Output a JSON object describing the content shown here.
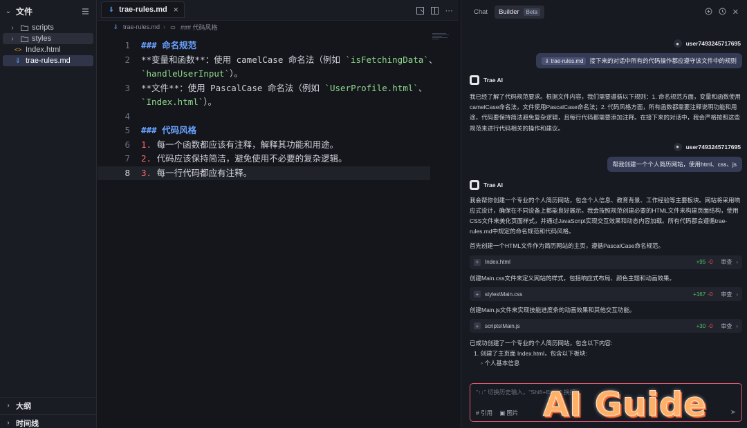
{
  "explorer": {
    "title": "文件",
    "items": [
      {
        "label": "scripts",
        "type": "folder"
      },
      {
        "label": "styles",
        "type": "folder"
      },
      {
        "label": "Index.html",
        "type": "html"
      },
      {
        "label": "trae-rules.md",
        "type": "md"
      }
    ],
    "outline_label": "大纲",
    "timeline_label": "时间线"
  },
  "editor": {
    "tab_label": "trae-rules.md",
    "tab_close": "×",
    "breadcrumb": [
      "trae-rules.md",
      "### 代码风格"
    ],
    "lines": [
      {
        "n": "1",
        "heading": "### 命名规范"
      },
      {
        "n": "2",
        "pre": "**变量和函数**：使用 camelCase 命名法（例如 ",
        "code": "`isFetchingData`",
        "post": "、"
      },
      {
        "n": "",
        "code": "`handleUserInput`",
        "post": "）。"
      },
      {
        "n": "3",
        "pre": "**文件**：使用 PascalCase 命名法（例如 ",
        "code": "`UserProfile.html`",
        "post": "、"
      },
      {
        "n": "",
        "code": "`Index.html`",
        "post": "）。"
      },
      {
        "n": "4",
        "pre": ""
      },
      {
        "n": "5",
        "heading": "### 代码风格"
      },
      {
        "n": "6",
        "num": "1.",
        "post": " 每一个函数都应该有注释，解释其功能和用途。"
      },
      {
        "n": "7",
        "num": "2.",
        "post": " 代码应该保持简洁，避免使用不必要的复杂逻辑。"
      },
      {
        "n": "8",
        "num": "3.",
        "post": " 每一行代码都应有注释。"
      }
    ]
  },
  "chat": {
    "tab_chat": "Chat",
    "tab_builder": "Builder",
    "beta": "Beta",
    "user_name": "user7493245717695",
    "ai_name": "Trae AI",
    "msg1_chip": "trae-rules.md",
    "msg1_text": "接下来的对话中所有的代码操作都应遵守该文件中的规则",
    "reply1": "我已经了解了代码规范要求。根据文件内容，我们需要遵循以下规则：1. 命名规范方面，变量和函数使用camelCase命名法，文件使用PascalCase命名法；2. 代码风格方面，所有函数都需要注释说明功能和用途，代码要保持简洁避免复杂逻辑，且每行代码都需要添加注释。在接下来的对话中，我会严格按照这些规范来进行代码相关的操作和建议。",
    "msg2_text": "帮我创建一个个人简历网站，使用html、css、js",
    "reply2": "我会帮你创建一个专业的个人简历网站，包含个人信息、教育背景、工作经验等主要板块。网站将采用响应式设计，确保在不同设备上都能良好展示。我会按照规范创建必要的HTML文件来构建页面结构，使用CSS文件来美化页面样式，并通过JavaScript实现交互效果和动态内容加载。所有代码都会遵循trae-rules.md中规定的命名规范和代码风格。",
    "step1": "首先创建一个HTML文件作为简历网站的主页，遵循PascalCase命名规范。",
    "file1": {
      "name": "Index.html",
      "add": "+95",
      "del": "-0",
      "review": "审查"
    },
    "step2": "创建Main.css文件来定义网站的样式，包括响应式布局、颜色主题和动画效果。",
    "file2": {
      "name": "styles\\Main.css",
      "add": "+167",
      "del": "-0",
      "review": "审查"
    },
    "step3": "创建Main.js文件来实现技能进度条的动画效果和其他交互功能。",
    "file3": {
      "name": "scripts\\Main.js",
      "add": "+30",
      "del": "-0",
      "review": "审查"
    },
    "summary": "已成功创建了一个专业的个人简历网站，包含以下内容:",
    "list1": "1. 创建了主页面 Index.html，包含以下板块:",
    "list1a": "个人基本信息",
    "input_placeholder": "\"↑↓\" 切换历史输入，\"Shift+Enter\" 换行",
    "tool_ref": "引用",
    "tool_img": "图片"
  },
  "watermark": "AI Guide",
  "colors": {
    "accent_heading": "#6aa2ff",
    "inline_code": "#8fd88c",
    "list_number": "#ff6a6a",
    "add": "#4fc36a",
    "del": "#e35d5d",
    "input_border": "#e05a73"
  }
}
